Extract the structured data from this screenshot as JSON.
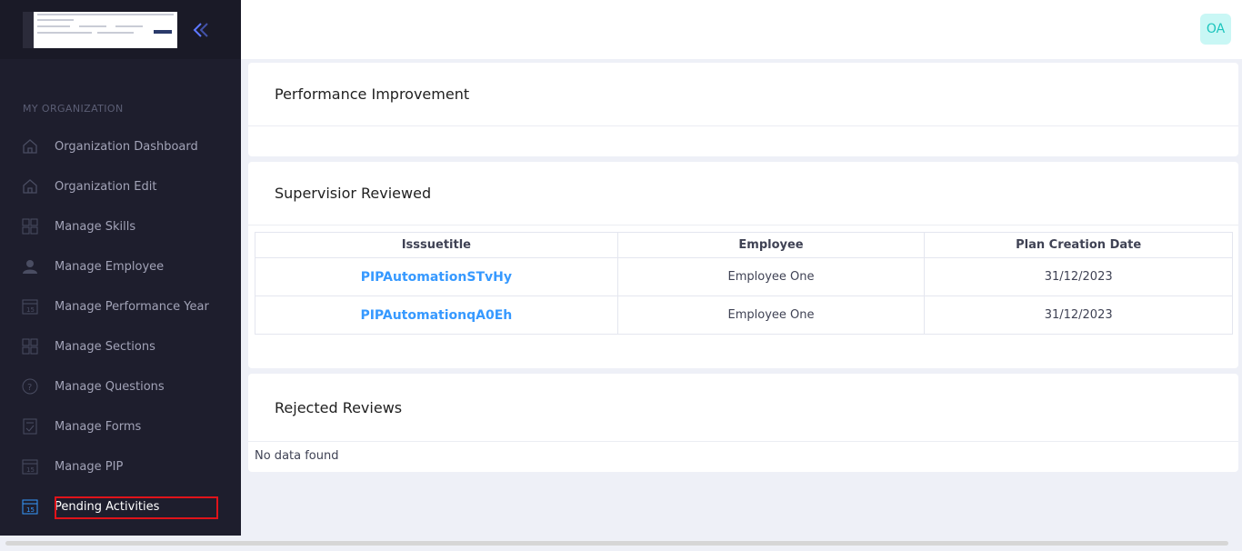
{
  "sidebar": {
    "section_title": "MY ORGANIZATION",
    "items": [
      {
        "label": "Organization Dashboard",
        "icon": "home-icon"
      },
      {
        "label": "Organization Edit",
        "icon": "home-icon"
      },
      {
        "label": "Manage Skills",
        "icon": "grid-icon"
      },
      {
        "label": "Manage Employee",
        "icon": "user-icon"
      },
      {
        "label": "Manage Performance Year",
        "icon": "calendar-icon"
      },
      {
        "label": "Manage Sections",
        "icon": "grid-icon"
      },
      {
        "label": "Manage Questions",
        "icon": "question-icon"
      },
      {
        "label": "Manage Forms",
        "icon": "form-icon"
      },
      {
        "label": "Manage PIP",
        "icon": "calendar-icon"
      },
      {
        "label": "Pending Activities",
        "icon": "calendar-icon",
        "active": true
      }
    ]
  },
  "topbar": {
    "avatar_initials": "OA"
  },
  "main": {
    "performance_card": {
      "title": "Performance Improvement"
    },
    "supervisor_card": {
      "title": "Supervisior Reviewed",
      "columns": [
        "Isssuetitle",
        "Employee",
        "Plan Creation Date"
      ],
      "rows": [
        [
          "PIPAutomationSTvHy",
          "Employee One",
          "31/12/2023"
        ],
        [
          "PIPAutomationqA0Eh",
          "Employee One",
          "31/12/2023"
        ]
      ]
    },
    "rejected_card": {
      "title": "Rejected Reviews",
      "empty_text": "No data found"
    }
  },
  "colors": {
    "sidebar_bg": "#1e1e2d",
    "link": "#3699ff",
    "accent_teal": "#1bc5bd",
    "highlight": "#e0131a"
  }
}
